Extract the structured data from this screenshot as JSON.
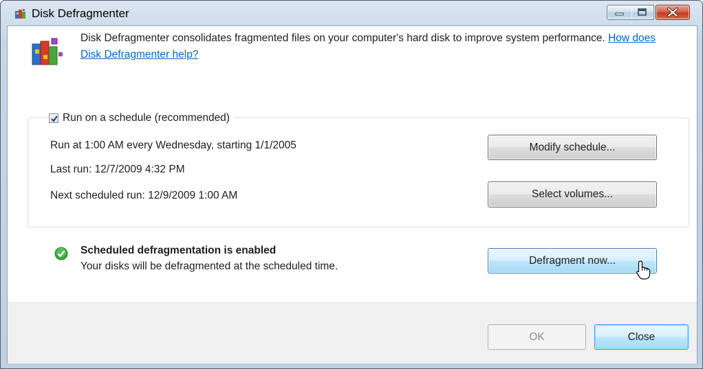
{
  "window": {
    "title": "Disk Defragmenter",
    "accent": "#3399ff",
    "close_color": "#c23b22"
  },
  "description": {
    "text": "Disk Defragmenter consolidates fragmented files on your computer's hard disk to improve system performance.",
    "help_link": "How does Disk Defragmenter help?"
  },
  "schedule": {
    "checkbox_label": "Run on a schedule (recommended)",
    "checked": true,
    "run_at": "Run at 1:00 AM every Wednesday, starting 1/1/2005",
    "last_run": "Last run: 12/7/2009 4:32 PM",
    "next_run": "Next scheduled run: 12/9/2009 1:00 AM",
    "modify_button": "Modify schedule...",
    "select_volumes_button": "Select volumes..."
  },
  "status": {
    "title": "Scheduled defragmentation is enabled",
    "subtitle": "Your disks will be defragmented at the scheduled time.",
    "icon": "check-circle-icon",
    "color": "#3ca63c"
  },
  "actions": {
    "defragment_now": "Defragment now...",
    "ok": "OK",
    "close": "Close"
  }
}
